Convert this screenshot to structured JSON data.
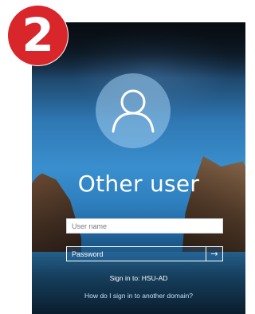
{
  "step_badge": {
    "number": "2",
    "color": "#d8262b"
  },
  "login": {
    "avatar_icon": "user-icon",
    "user_title": "Other user",
    "username_field": {
      "placeholder": "User name",
      "value": ""
    },
    "password_field": {
      "placeholder": "Password",
      "value": ""
    },
    "submit_icon": "arrow-right-icon",
    "submit_glyph": "→",
    "sign_in_to": "Sign in to: HSU-AD",
    "other_domain_link": "How do I sign in to another domain?"
  },
  "colors": {
    "background_blue": "#3a8fce",
    "link": "#bfe0ff",
    "text": "#ffffff"
  }
}
